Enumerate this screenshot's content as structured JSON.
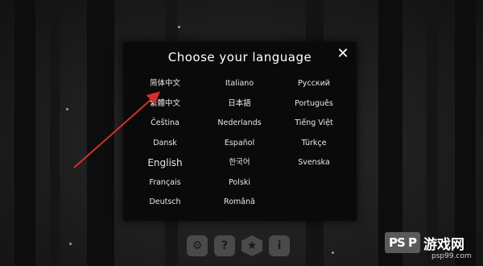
{
  "dialog": {
    "title": "Choose your language",
    "close_icon": "close-x-icon"
  },
  "languages": [
    "简体中文",
    "Italiano",
    "Русский",
    "繁體中文",
    "日本語",
    "Português",
    "Čeština",
    "Nederlands",
    "Tiếng Việt",
    "Dansk",
    "Español",
    "Türkçe",
    "English",
    "한국어",
    "Svenska",
    "Français",
    "Polski",
    "",
    "Deutsch",
    "Română",
    ""
  ],
  "bottom_menu": {
    "icons": [
      "gear-icon",
      "help-icon",
      "star-icon",
      "info-icon"
    ],
    "labels": [
      "⚙",
      "?",
      "★",
      "i"
    ]
  },
  "watermark": {
    "logo": "PS P",
    "name": "游戏网",
    "url": "psp99.com"
  },
  "colors": {
    "dialog_bg": "#0a0a0a",
    "text": "#e8e8e8",
    "annotation_arrow": "#d32f2f"
  }
}
